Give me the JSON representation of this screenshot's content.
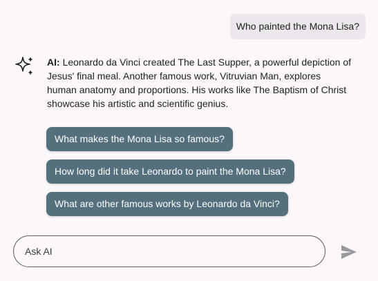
{
  "user_message": "Who painted the Mona Lisa?",
  "ai_response": {
    "label": "AI:",
    "text": "Leonardo da Vinci created The Last Supper, a powerful depiction of Jesus' final meal. Another famous work, Vitruvian Man, explores human anatomy and proportions. His works like The Baptism of Christ showcase his artistic and scientific genius."
  },
  "suggestions": [
    "What makes the Mona Lisa so famous?",
    "How long did it take Leonardo to paint the Mona Lisa?",
    "What are other famous works by Leonardo da Vinci?"
  ],
  "input": {
    "placeholder": "Ask AI",
    "value": ""
  },
  "icons": {
    "ai": "sparkle-icon",
    "send": "send-icon"
  },
  "colors": {
    "background": "#fcf7fb",
    "user_bubble": "#ece7ec",
    "suggestion_chip": "#53707c",
    "send_icon": "#9a9a9e"
  }
}
